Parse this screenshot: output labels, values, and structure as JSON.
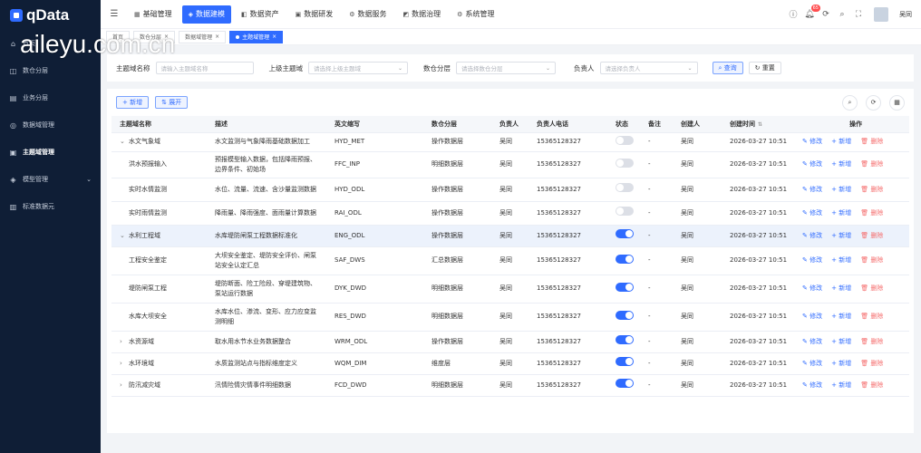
{
  "app": {
    "logo_text": "qData",
    "watermark": "aileyu.com.cn"
  },
  "sidebar": {
    "items": [
      {
        "label": "首页",
        "icon": "home-icon"
      },
      {
        "label": "数仓分层",
        "icon": "layers-icon"
      },
      {
        "label": "业务分层",
        "icon": "business-icon"
      },
      {
        "label": "数据域管理",
        "icon": "domain-icon"
      },
      {
        "label": "主题域管理",
        "icon": "topic-icon",
        "active": true
      },
      {
        "label": "模型管理",
        "icon": "model-icon"
      },
      {
        "label": "标准数据元",
        "icon": "standard-icon"
      }
    ]
  },
  "topnav": {
    "items": [
      {
        "label": "基础管理",
        "icon": "grid-icon"
      },
      {
        "label": "数据建模",
        "icon": "model-icon",
        "active": true
      },
      {
        "label": "数据资产",
        "icon": "asset-icon"
      },
      {
        "label": "数据研发",
        "icon": "dev-icon"
      },
      {
        "label": "数据服务",
        "icon": "service-icon"
      },
      {
        "label": "数据治理",
        "icon": "govern-icon"
      },
      {
        "label": "系统管理",
        "icon": "settings-icon"
      }
    ],
    "notification_count": "65",
    "username": "吴同"
  },
  "tabs": [
    {
      "label": "首页"
    },
    {
      "label": "数仓分层"
    },
    {
      "label": "数据域管理"
    },
    {
      "label": "主题域管理",
      "active": true
    }
  ],
  "filter": {
    "topic_name_label": "主题域名称",
    "topic_name_placeholder": "请输入主题域名称",
    "parent_label": "上级主题域",
    "parent_placeholder": "请选择上级主题域",
    "layer_label": "数仓分层",
    "layer_placeholder": "请选择数仓分层",
    "owner_label": "负责人",
    "owner_placeholder": "请选择负责人",
    "search_button": "查询",
    "reset_button": "重置"
  },
  "toolbar": {
    "add_button": "+ 新增",
    "expand_button": "展开"
  },
  "table": {
    "columns": [
      "主题域名称",
      "描述",
      "英文缩写",
      "数仓分层",
      "负责人",
      "负责人电话",
      "状态",
      "备注",
      "创建人",
      "创建时间",
      "操作"
    ],
    "ops": {
      "edit": "修改",
      "add": "新增",
      "delete": "删除"
    },
    "rows": [
      {
        "name": "水文气象域",
        "level": 0,
        "expanded": true,
        "desc": [
          "水文监测与气象降雨基础数据加工"
        ],
        "abbr": "HYD_MET",
        "layer": "操作数据层",
        "owner": "吴同",
        "phone": "15365128327",
        "status": false,
        "remark": "-",
        "creator": "吴同",
        "time": "2026-03-27 10:51"
      },
      {
        "name": "洪水预报输入",
        "level": 1,
        "desc": [
          "预报模型输入数据，包括降雨预报、",
          "边界条件、初始场"
        ],
        "abbr": "FFC_INP",
        "layer": "明细数据层",
        "owner": "吴同",
        "phone": "15365128327",
        "status": false,
        "remark": "-",
        "creator": "吴同",
        "time": "2026-03-27 10:51"
      },
      {
        "name": "实时水情监测",
        "level": 1,
        "desc": [
          "水位、流量、流速、含沙量监测数据"
        ],
        "abbr": "HYD_ODL",
        "layer": "操作数据层",
        "owner": "吴同",
        "phone": "15365128327",
        "status": false,
        "remark": "-",
        "creator": "吴同",
        "time": "2026-03-27 10:51"
      },
      {
        "name": "实时雨情监测",
        "level": 1,
        "desc": [
          "降雨量、降雨强度、面雨量计算数据"
        ],
        "abbr": "RAI_ODL",
        "layer": "操作数据层",
        "owner": "吴同",
        "phone": "15365128327",
        "status": false,
        "remark": "-",
        "creator": "吴同",
        "time": "2026-03-27 10:51"
      },
      {
        "name": "水利工程域",
        "level": 0,
        "expanded": true,
        "highlight": true,
        "desc": [
          "水库堤防闸泵工程数据标准化"
        ],
        "abbr": "ENG_ODL",
        "layer": "操作数据层",
        "owner": "吴同",
        "phone": "15365128327",
        "status": true,
        "remark": "-",
        "creator": "吴同",
        "time": "2026-03-27 10:51"
      },
      {
        "name": "工程安全鉴定",
        "level": 1,
        "desc": [
          "大坝安全鉴定、堤防安全评价、闸泵",
          "站安全认定汇总"
        ],
        "abbr": "SAF_DWS",
        "layer": "汇总数据层",
        "owner": "吴同",
        "phone": "15365128327",
        "status": true,
        "remark": "-",
        "creator": "吴同",
        "time": "2026-03-27 10:51"
      },
      {
        "name": "堤防闸泵工程",
        "level": 1,
        "desc": [
          "堤防断面、险工险段、穿堤建筑物、",
          "泵站运行数据"
        ],
        "abbr": "DYK_DWD",
        "layer": "明细数据层",
        "owner": "吴同",
        "phone": "15365128327",
        "status": true,
        "remark": "-",
        "creator": "吴同",
        "time": "2026-03-27 10:51"
      },
      {
        "name": "水库大坝安全",
        "level": 1,
        "desc": [
          "水库水位、渗流、变形、应力应变监",
          "测明细"
        ],
        "abbr": "RES_DWD",
        "layer": "明细数据层",
        "owner": "吴同",
        "phone": "15365128327",
        "status": true,
        "remark": "-",
        "creator": "吴同",
        "time": "2026-03-27 10:51"
      },
      {
        "name": "水资源域",
        "level": 0,
        "expanded": false,
        "desc": [
          "取水用水节水业务数据整合"
        ],
        "abbr": "WRM_ODL",
        "layer": "操作数据层",
        "owner": "吴同",
        "phone": "15365128327",
        "status": true,
        "remark": "-",
        "creator": "吴同",
        "time": "2026-03-27 10:51"
      },
      {
        "name": "水环境域",
        "level": 0,
        "expanded": false,
        "desc": [
          "水质监测站点与指标维度定义"
        ],
        "abbr": "WQM_DIM",
        "layer": "维度层",
        "owner": "吴同",
        "phone": "15365128327",
        "status": true,
        "remark": "-",
        "creator": "吴同",
        "time": "2026-03-27 10:51"
      },
      {
        "name": "防汛减灾域",
        "level": 0,
        "expanded": false,
        "desc": [
          "汛情险情灾情事件明细数据"
        ],
        "abbr": "FCD_DWD",
        "layer": "明细数据层",
        "owner": "吴同",
        "phone": "15365128327",
        "status": true,
        "remark": "-",
        "creator": "吴同",
        "time": "2026-03-27 10:51"
      }
    ]
  },
  "colors": {
    "primary": "#2f6bff",
    "sidebar_bg": "#0f1e36",
    "danger": "#f56c6c",
    "row_highlight": "#ecf2fc"
  }
}
